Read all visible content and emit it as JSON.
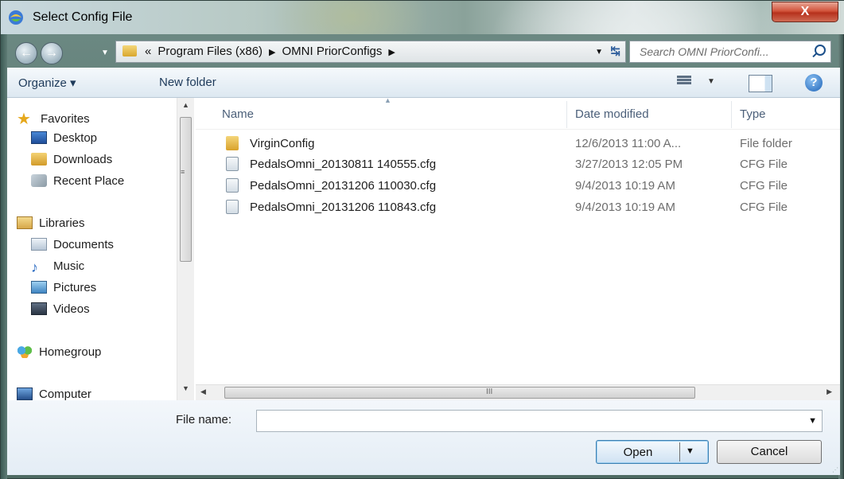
{
  "window": {
    "title": "Select Config File",
    "close_label": "X"
  },
  "address": {
    "overflow": "«",
    "crumbs": [
      "Program Files (x86)",
      "OMNI PriorConfigs"
    ],
    "separator": "▶",
    "search_placeholder": "Search OMNI PriorConfi..."
  },
  "toolbar": {
    "organize_label": "Organize ▾",
    "new_folder_label": "New folder",
    "help_label": "?"
  },
  "nav": {
    "favorites": "Favorites",
    "desktop": "Desktop",
    "downloads": "Downloads",
    "recent": "Recent Place",
    "libraries": "Libraries",
    "documents": "Documents",
    "music": "Music",
    "pictures": "Pictures",
    "videos": "Videos",
    "homegroup": "Homegroup",
    "computer": "Computer"
  },
  "columns": {
    "name": "Name",
    "date": "Date modified",
    "type": "Type"
  },
  "files": [
    {
      "name": "VirginConfig",
      "date": "12/6/2013 11:00 A...",
      "type": "File folder",
      "icon": "folder-icon"
    },
    {
      "name": "PedalsOmni_20130811 140555.cfg",
      "date": "3/27/2013 12:05 PM",
      "type": "CFG File",
      "icon": "cfg-file-icon"
    },
    {
      "name": "PedalsOmni_20131206 110030.cfg",
      "date": "9/4/2013 10:19 AM",
      "type": "CFG File",
      "icon": "cfg-file-icon"
    },
    {
      "name": "PedalsOmni_20131206 110843.cfg",
      "date": "9/4/2013 10:19 AM",
      "type": "CFG File",
      "icon": "cfg-file-icon"
    }
  ],
  "scroll_grip": "III",
  "bottom": {
    "file_name_label": "File name:",
    "file_name_value": "",
    "open_label": "Open",
    "cancel_label": "Cancel"
  },
  "colors": {
    "accent": "#3c7fb1",
    "close": "#c8432c",
    "toolbar_text": "#1e3a5a"
  }
}
